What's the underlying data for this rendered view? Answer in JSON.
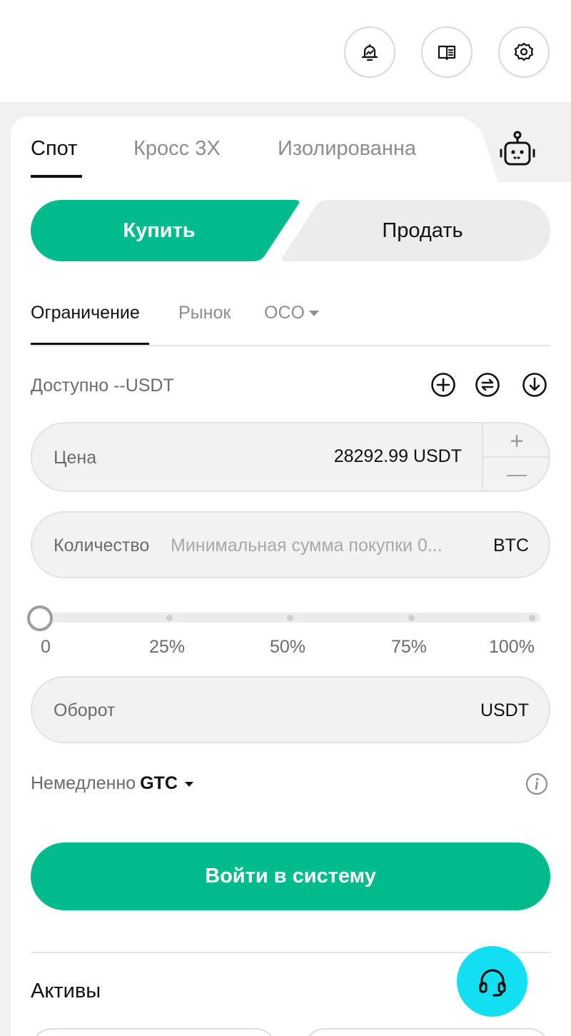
{
  "header": {
    "icons": [
      "price-alert-icon",
      "guide-book-icon",
      "settings-gear-icon"
    ]
  },
  "tabs": [
    {
      "label": "Спот",
      "active": true
    },
    {
      "label": "Кросс 3X",
      "active": false
    },
    {
      "label": "Изолированна",
      "active": false
    }
  ],
  "trade_bot_icon": "robot-icon",
  "side": {
    "buy_label": "Купить",
    "sell_label": "Продать",
    "active": "buy"
  },
  "order_types": [
    {
      "label": "Ограничение",
      "active": true
    },
    {
      "label": "Рынок",
      "active": false
    },
    {
      "label": "OCO",
      "active": false,
      "has_dropdown": true
    }
  ],
  "available": {
    "label": "Доступно --USDT",
    "icons": [
      "add-circle-icon",
      "transfer-circle-icon",
      "download-circle-icon"
    ]
  },
  "price_field": {
    "label": "Цена",
    "value": "28292.99 USDT",
    "increment_glyph": "+",
    "decrement_glyph": "—"
  },
  "quantity_field": {
    "label": "Количество",
    "placeholder": "Минимальная сумма покупки 0...",
    "unit": "BTC"
  },
  "slider": {
    "value_percent": 0,
    "ticks": [
      "0",
      "25%",
      "50%",
      "75%",
      "100%"
    ]
  },
  "turnover_field": {
    "label": "Оборот",
    "unit": "USDT"
  },
  "time_in_force": {
    "label": "Немедленно",
    "value": "GTC"
  },
  "login_button": "Войти в систему",
  "assets": {
    "title": "Активы"
  },
  "colors": {
    "accent_green": "#00bc8c",
    "support_cyan": "#12dff2"
  }
}
